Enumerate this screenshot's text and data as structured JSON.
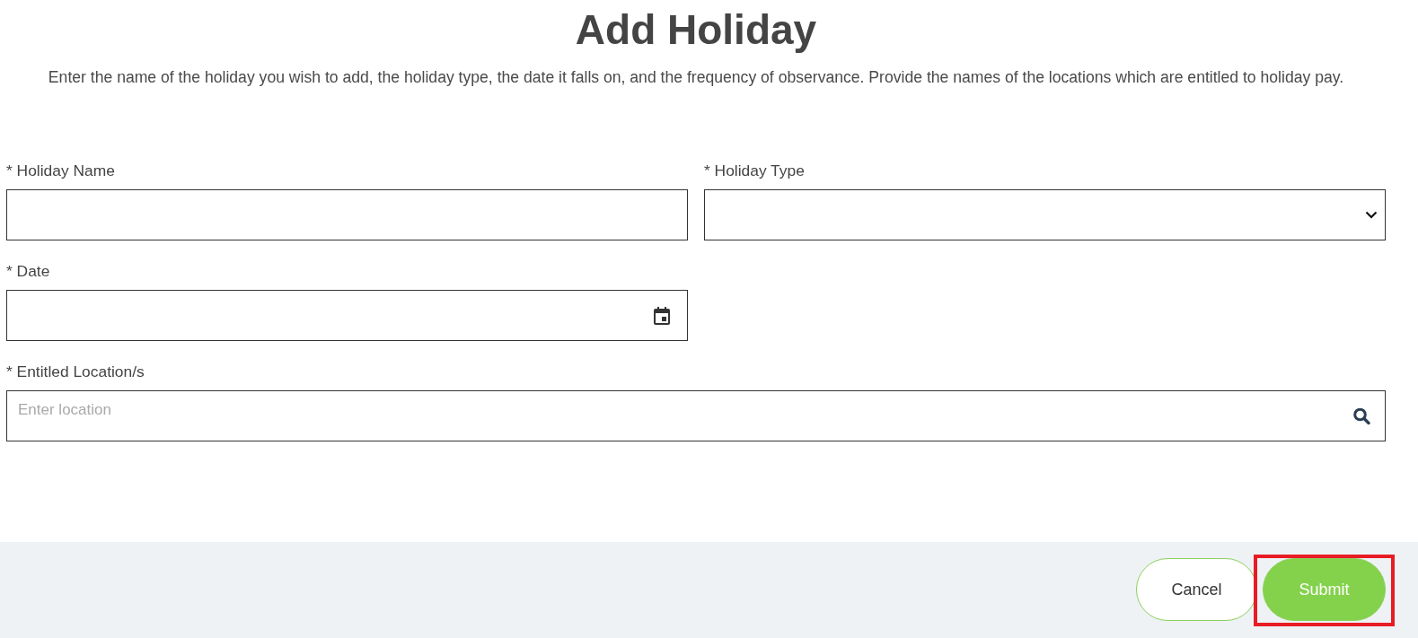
{
  "title": "Add Holiday",
  "description": "Enter the name of the holiday you wish to add, the holiday type, the date it falls on, and the frequency of observance. Provide the names of the locations which are entitled to holiday pay.",
  "fields": [
    {
      "label": "* Holiday Name",
      "kind": "text"
    },
    {
      "label": "* Holiday Type",
      "kind": "select"
    },
    {
      "label": "* Date",
      "kind": "date"
    },
    {
      "label": "* Entitled Location/s",
      "kind": "search",
      "placeholder": "Enter location"
    }
  ],
  "buttons": [
    {
      "label": "Cancel",
      "kind": "secondary",
      "highlighted": false
    },
    {
      "label": "Submit",
      "kind": "primary",
      "highlighted": true
    }
  ]
}
